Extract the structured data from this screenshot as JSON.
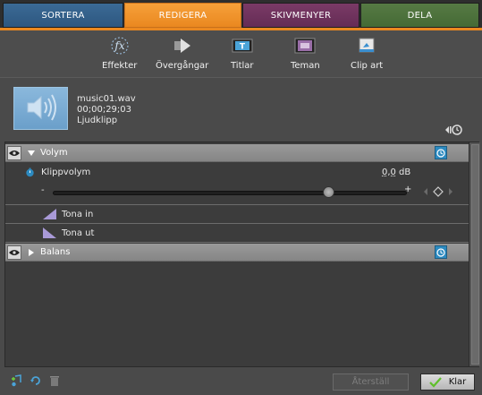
{
  "tabs": [
    {
      "label": "SORTERA"
    },
    {
      "label": "REDIGERA",
      "active": true
    },
    {
      "label": "SKIVMENYER"
    },
    {
      "label": "DELA"
    }
  ],
  "toolbar": {
    "items": [
      {
        "label": "Effekter",
        "icon": "fx-icon"
      },
      {
        "label": "Övergångar",
        "icon": "transition-arrow-icon"
      },
      {
        "label": "Titlar",
        "icon": "title-film-icon"
      },
      {
        "label": "Teman",
        "icon": "themes-film-icon"
      },
      {
        "label": "Clip art",
        "icon": "clip-art-icon"
      }
    ]
  },
  "clip": {
    "filename": "music01.wav",
    "duration": "00;00;29;03",
    "type": "Ljudklipp",
    "thumbnail_icon": "speaker-icon"
  },
  "properties": {
    "volume": {
      "label": "Volym",
      "expanded": true,
      "clip_volume_label": "Klippvolym",
      "value": "0,0",
      "unit": "dB",
      "slider_min_label": "-",
      "slider_max_label": "+",
      "slider_fraction": 0.78,
      "fade_in_label": "Tona in",
      "fade_out_label": "Tona ut"
    },
    "balance": {
      "label": "Balans",
      "expanded": false
    }
  },
  "bottom": {
    "reset_label": "Återställ",
    "done_label": "Klar"
  },
  "colors": {
    "active_tab": "#ea8820",
    "sortera_tab": "#2d5780",
    "skivmenyer_tab": "#652c55",
    "dela_tab": "#456a35",
    "keyframe_clock": "#2c8ac0",
    "done_check": "#5fbf2a"
  }
}
